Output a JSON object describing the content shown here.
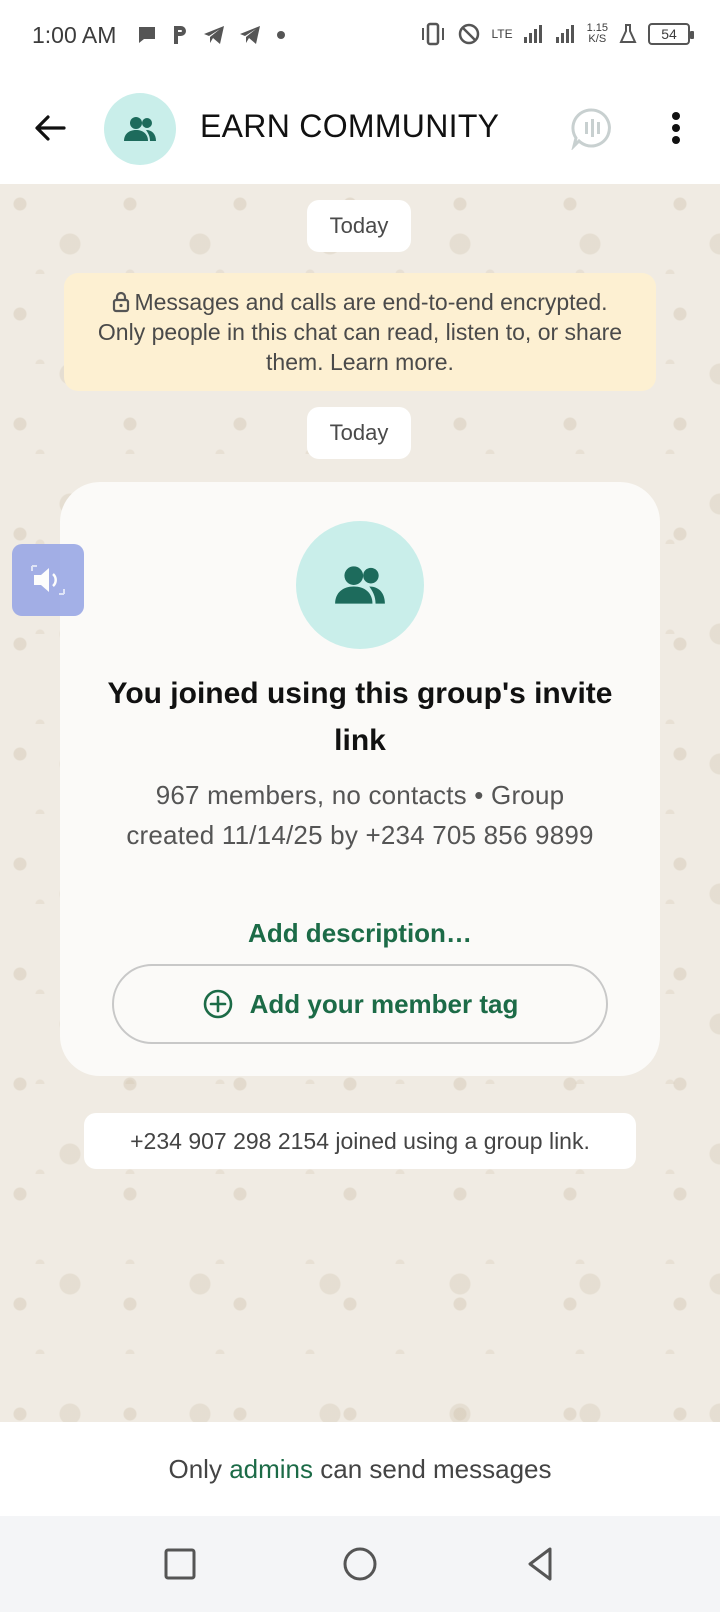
{
  "status_bar": {
    "time": "1:00 AM",
    "network_label": "LTE",
    "speed_value": "1.15",
    "speed_unit": "K/S",
    "battery": "54"
  },
  "header": {
    "title": "EARN COMMUNITY"
  },
  "chat": {
    "date_chip_1": "Today",
    "encryption_notice": "Messages and calls are end-to-end encrypted. Only people in this chat can read, listen to, or share them. Learn more.",
    "date_chip_2": "Today",
    "card": {
      "heading": "You joined using this group's invite link",
      "details": "967 members, no contacts • Group created 11/14/25 by +234 705 856 9899",
      "add_description": "Add description…",
      "member_tag_button": "Add your member tag"
    },
    "system_message": "+234 907 298 2154 joined using a group link."
  },
  "footer": {
    "prefix": "Only",
    "admins": "admins",
    "suffix": "can send messages"
  },
  "colors": {
    "accent_green": "#1c6b47",
    "avatar_bg": "#c9eeea",
    "encryption_bg": "#fdf0d2",
    "chat_bg": "#f0ebe3"
  }
}
